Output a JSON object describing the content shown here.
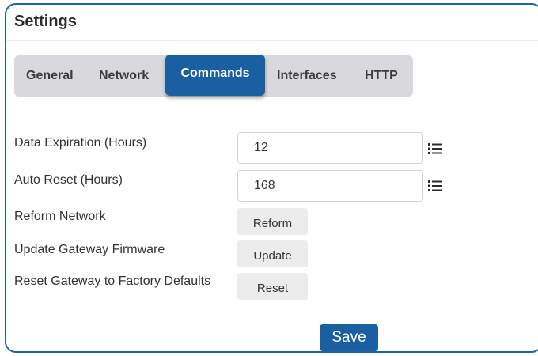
{
  "panel": {
    "title": "Settings"
  },
  "tabs": [
    {
      "label": "General",
      "active": false
    },
    {
      "label": "Network",
      "active": false
    },
    {
      "label": "Commands",
      "active": true
    },
    {
      "label": "Interfaces",
      "active": false
    },
    {
      "label": "HTTP",
      "active": false
    }
  ],
  "fields": {
    "data_expiration": {
      "label": "Data Expiration (Hours)",
      "value": "12",
      "icon": "list-icon"
    },
    "auto_reset": {
      "label": "Auto Reset (Hours)",
      "value": "168",
      "icon": "list-icon"
    }
  },
  "actions": {
    "reform_network": {
      "label": "Reform Network",
      "button": "Reform"
    },
    "update_firmware": {
      "label": "Update Gateway Firmware",
      "button": "Update"
    },
    "factory_reset": {
      "label": "Reset Gateway to Factory Defaults",
      "button": "Reset"
    }
  },
  "footer": {
    "save_label": "Save"
  },
  "colors": {
    "accent": "#1b5fa3",
    "panel_border": "#1f63a1",
    "tab_bar": "#d9d9dd",
    "button_gray": "#ececec"
  }
}
